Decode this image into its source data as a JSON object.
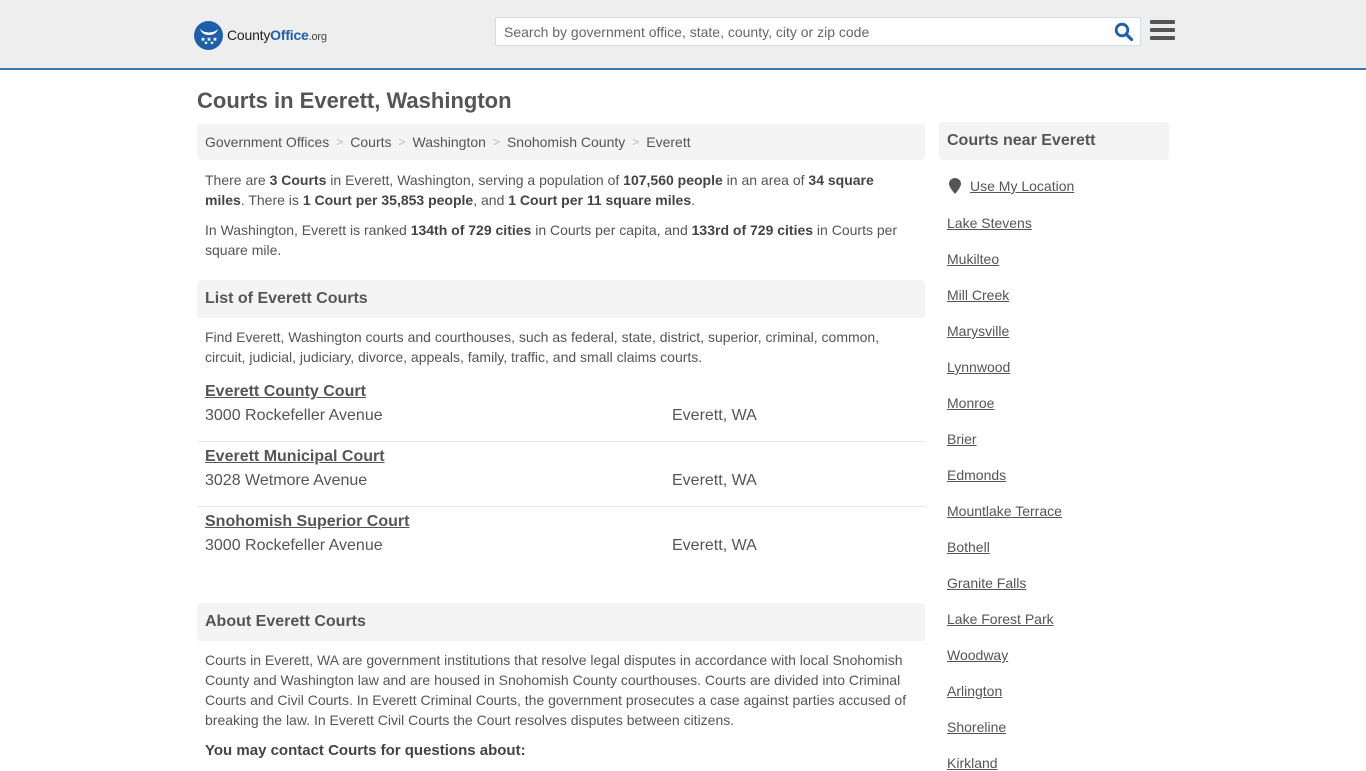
{
  "header": {
    "logo": {
      "name_part1": "County",
      "name_part2": "Office",
      "tld": ".org"
    },
    "search": {
      "placeholder": "Search by government office, state, county, city or zip code",
      "value": ""
    },
    "icons": {
      "search": "search-icon",
      "menu": "hamburger-menu-icon"
    },
    "accent_color": "#3a79b0",
    "brand_color": "#1f5ea8"
  },
  "page": {
    "title": "Courts in Everett, Washington"
  },
  "breadcrumb": [
    {
      "label": "Government Offices"
    },
    {
      "label": "Courts"
    },
    {
      "label": "Washington"
    },
    {
      "label": "Snohomish County"
    },
    {
      "label": "Everett"
    }
  ],
  "summary": {
    "p1": {
      "t1": "There are ",
      "b1": "3 Courts",
      "t2": " in Everett, Washington, serving a population of ",
      "b2": "107,560 people",
      "t3": " in an area of ",
      "b3": "34 square miles",
      "t4": ". There is ",
      "b4": "1 Court per 35,853 people",
      "t5": ", and ",
      "b5": "1 Court per 11 square miles",
      "t6": "."
    },
    "p2": {
      "t1": "In Washington, Everett is ranked ",
      "b1": "134th of 729 cities",
      "t2": " in Courts per capita, and ",
      "b2": "133rd of 729 cities",
      "t3": " in Courts per square mile."
    }
  },
  "list_section": {
    "heading": "List of Everett Courts",
    "description": "Find Everett, Washington courts and courthouses, such as federal, state, district, superior, criminal, common, circuit, judicial, judiciary, divorce, appeals, family, traffic, and small claims courts.",
    "courts": [
      {
        "name": "Everett County Court",
        "address": "3000 Rockefeller Avenue",
        "city": "Everett, WA"
      },
      {
        "name": "Everett Municipal Court",
        "address": "3028 Wetmore Avenue",
        "city": "Everett, WA"
      },
      {
        "name": "Snohomish Superior Court",
        "address": "3000 Rockefeller Avenue",
        "city": "Everett, WA"
      }
    ]
  },
  "about_section": {
    "heading": "About Everett Courts",
    "body": "Courts in Everett, WA are government institutions that resolve legal disputes in accordance with local Snohomish County and Washington law and are housed in Snohomish County courthouses. Courts are divided into Criminal Courts and Civil Courts. In Everett Criminal Courts, the government prosecutes a case against parties accused of breaking the law. In Everett Civil Courts the Court resolves disputes between citizens.",
    "contact_heading": "You may contact Courts for questions about:"
  },
  "sidebar": {
    "heading": "Courts near Everett",
    "use_location": "Use My Location",
    "location_icon": "map-marker-icon",
    "nearby": [
      "Lake Stevens",
      "Mukilteo",
      "Mill Creek",
      "Marysville",
      "Lynnwood",
      "Monroe",
      "Brier",
      "Edmonds",
      "Mountlake Terrace",
      "Bothell",
      "Granite Falls",
      "Lake Forest Park",
      "Woodway",
      "Arlington",
      "Shoreline",
      "Kirkland"
    ]
  }
}
